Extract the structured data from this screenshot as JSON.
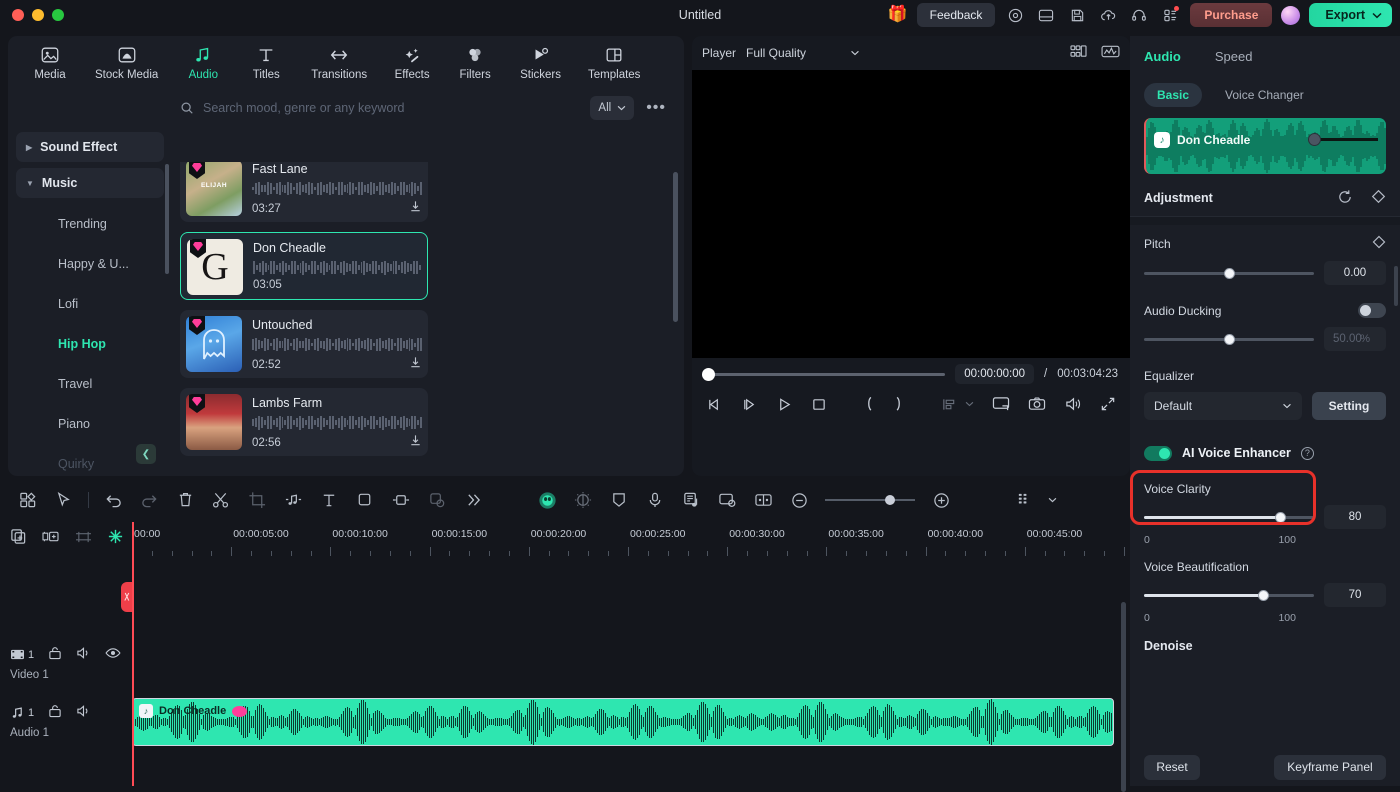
{
  "titlebar": {
    "document_title": "Untitled",
    "feedback_label": "Feedback",
    "purchase_label": "Purchase",
    "export_label": "Export",
    "icons": [
      "gift-icon",
      "record-icon",
      "layout-icon",
      "save-icon",
      "cloud-upload-icon",
      "support-icon",
      "apps-icon"
    ]
  },
  "top_tabs": [
    {
      "label": "Media",
      "icon": "media-icon",
      "active": false
    },
    {
      "label": "Stock Media",
      "icon": "stock-media-icon",
      "active": false
    },
    {
      "label": "Audio",
      "icon": "audio-note-icon",
      "active": true
    },
    {
      "label": "Titles",
      "icon": "titles-text-icon",
      "active": false
    },
    {
      "label": "Transitions",
      "icon": "transitions-icon",
      "active": false
    },
    {
      "label": "Effects",
      "icon": "effects-wand-icon",
      "active": false
    },
    {
      "label": "Filters",
      "icon": "filters-circles-icon",
      "active": false
    },
    {
      "label": "Stickers",
      "icon": "stickers-icon",
      "active": false
    },
    {
      "label": "Templates",
      "icon": "templates-icon",
      "active": false
    }
  ],
  "search": {
    "placeholder": "Search mood, genre or any keyword",
    "value": "",
    "filter_label": "All",
    "more_label": "•••"
  },
  "categories": {
    "groups": [
      {
        "label": "Sound Effect",
        "expanded": false
      },
      {
        "label": "Music",
        "expanded": true
      }
    ],
    "items": [
      {
        "label": "Trending",
        "active": false
      },
      {
        "label": "Happy & U...",
        "active": false
      },
      {
        "label": "Lofi",
        "active": false
      },
      {
        "label": "Hip Hop",
        "active": true
      },
      {
        "label": "Travel",
        "active": false
      },
      {
        "label": "Piano",
        "active": false
      },
      {
        "label": "Quirky",
        "active": false
      }
    ]
  },
  "music_list": [
    {
      "name": "Fast Lane",
      "duration": "03:27",
      "selected": false,
      "thumb_text": "ELIJAH"
    },
    {
      "name": "Don Cheadle",
      "duration": "03:05",
      "selected": true,
      "thumb_text": "G"
    },
    {
      "name": "Untouched",
      "duration": "02:52",
      "selected": false,
      "thumb_text": ""
    },
    {
      "name": "Lambs Farm",
      "duration": "02:56",
      "selected": false,
      "thumb_text": ""
    }
  ],
  "player": {
    "label": "Player",
    "quality": "Full Quality",
    "current_time": "00:00:00:00",
    "separator": "/",
    "total_time": "00:03:04:23"
  },
  "timeline": {
    "ruler_ticks": [
      "00:00",
      "00:00:05:00",
      "00:00:10:00",
      "00:00:15:00",
      "00:00:20:00",
      "00:00:25:00",
      "00:00:30:00",
      "00:00:35:00",
      "00:00:40:00",
      "00:00:45:00"
    ],
    "tracks": [
      {
        "name": "Video 1",
        "count": "1",
        "type": "video"
      },
      {
        "name": "Audio 1",
        "count": "1",
        "type": "audio"
      }
    ],
    "clip_label": "Don Cheadle",
    "zoom_level": 66
  },
  "right_panel": {
    "tabs": [
      {
        "label": "Audio",
        "active": true
      },
      {
        "label": "Speed",
        "active": false
      }
    ],
    "subtabs": [
      {
        "label": "Basic",
        "active": true
      },
      {
        "label": "Voice Changer",
        "active": false
      }
    ],
    "preview_name": "Don Cheadle",
    "adjustment_title": "Adjustment",
    "pitch": {
      "label": "Pitch",
      "value": "0.00",
      "percent": 50
    },
    "audio_ducking": {
      "label": "Audio Ducking",
      "value": "50.00",
      "unit": "%",
      "enabled": false,
      "percent": 50
    },
    "equalizer": {
      "label": "Equalizer",
      "selected": "Default",
      "setting_label": "Setting"
    },
    "ai_voice_enhancer": {
      "label": "AI Voice Enhancer",
      "enabled": true
    },
    "voice_clarity": {
      "label": "Voice Clarity",
      "value": "80",
      "min": "0",
      "max": "100",
      "percent": 80
    },
    "voice_beautification": {
      "label": "Voice Beautification",
      "value": "70",
      "min": "0",
      "max": "100",
      "percent": 70
    },
    "denoise": {
      "label": "Denoise"
    },
    "reset_label": "Reset",
    "keyframe_label": "Keyframe Panel"
  },
  "colors": {
    "accent": "#2ee6b0",
    "highlight_box": "#e8312a",
    "playhead": "#ff4b55",
    "purchase": "#ff9d8d"
  }
}
